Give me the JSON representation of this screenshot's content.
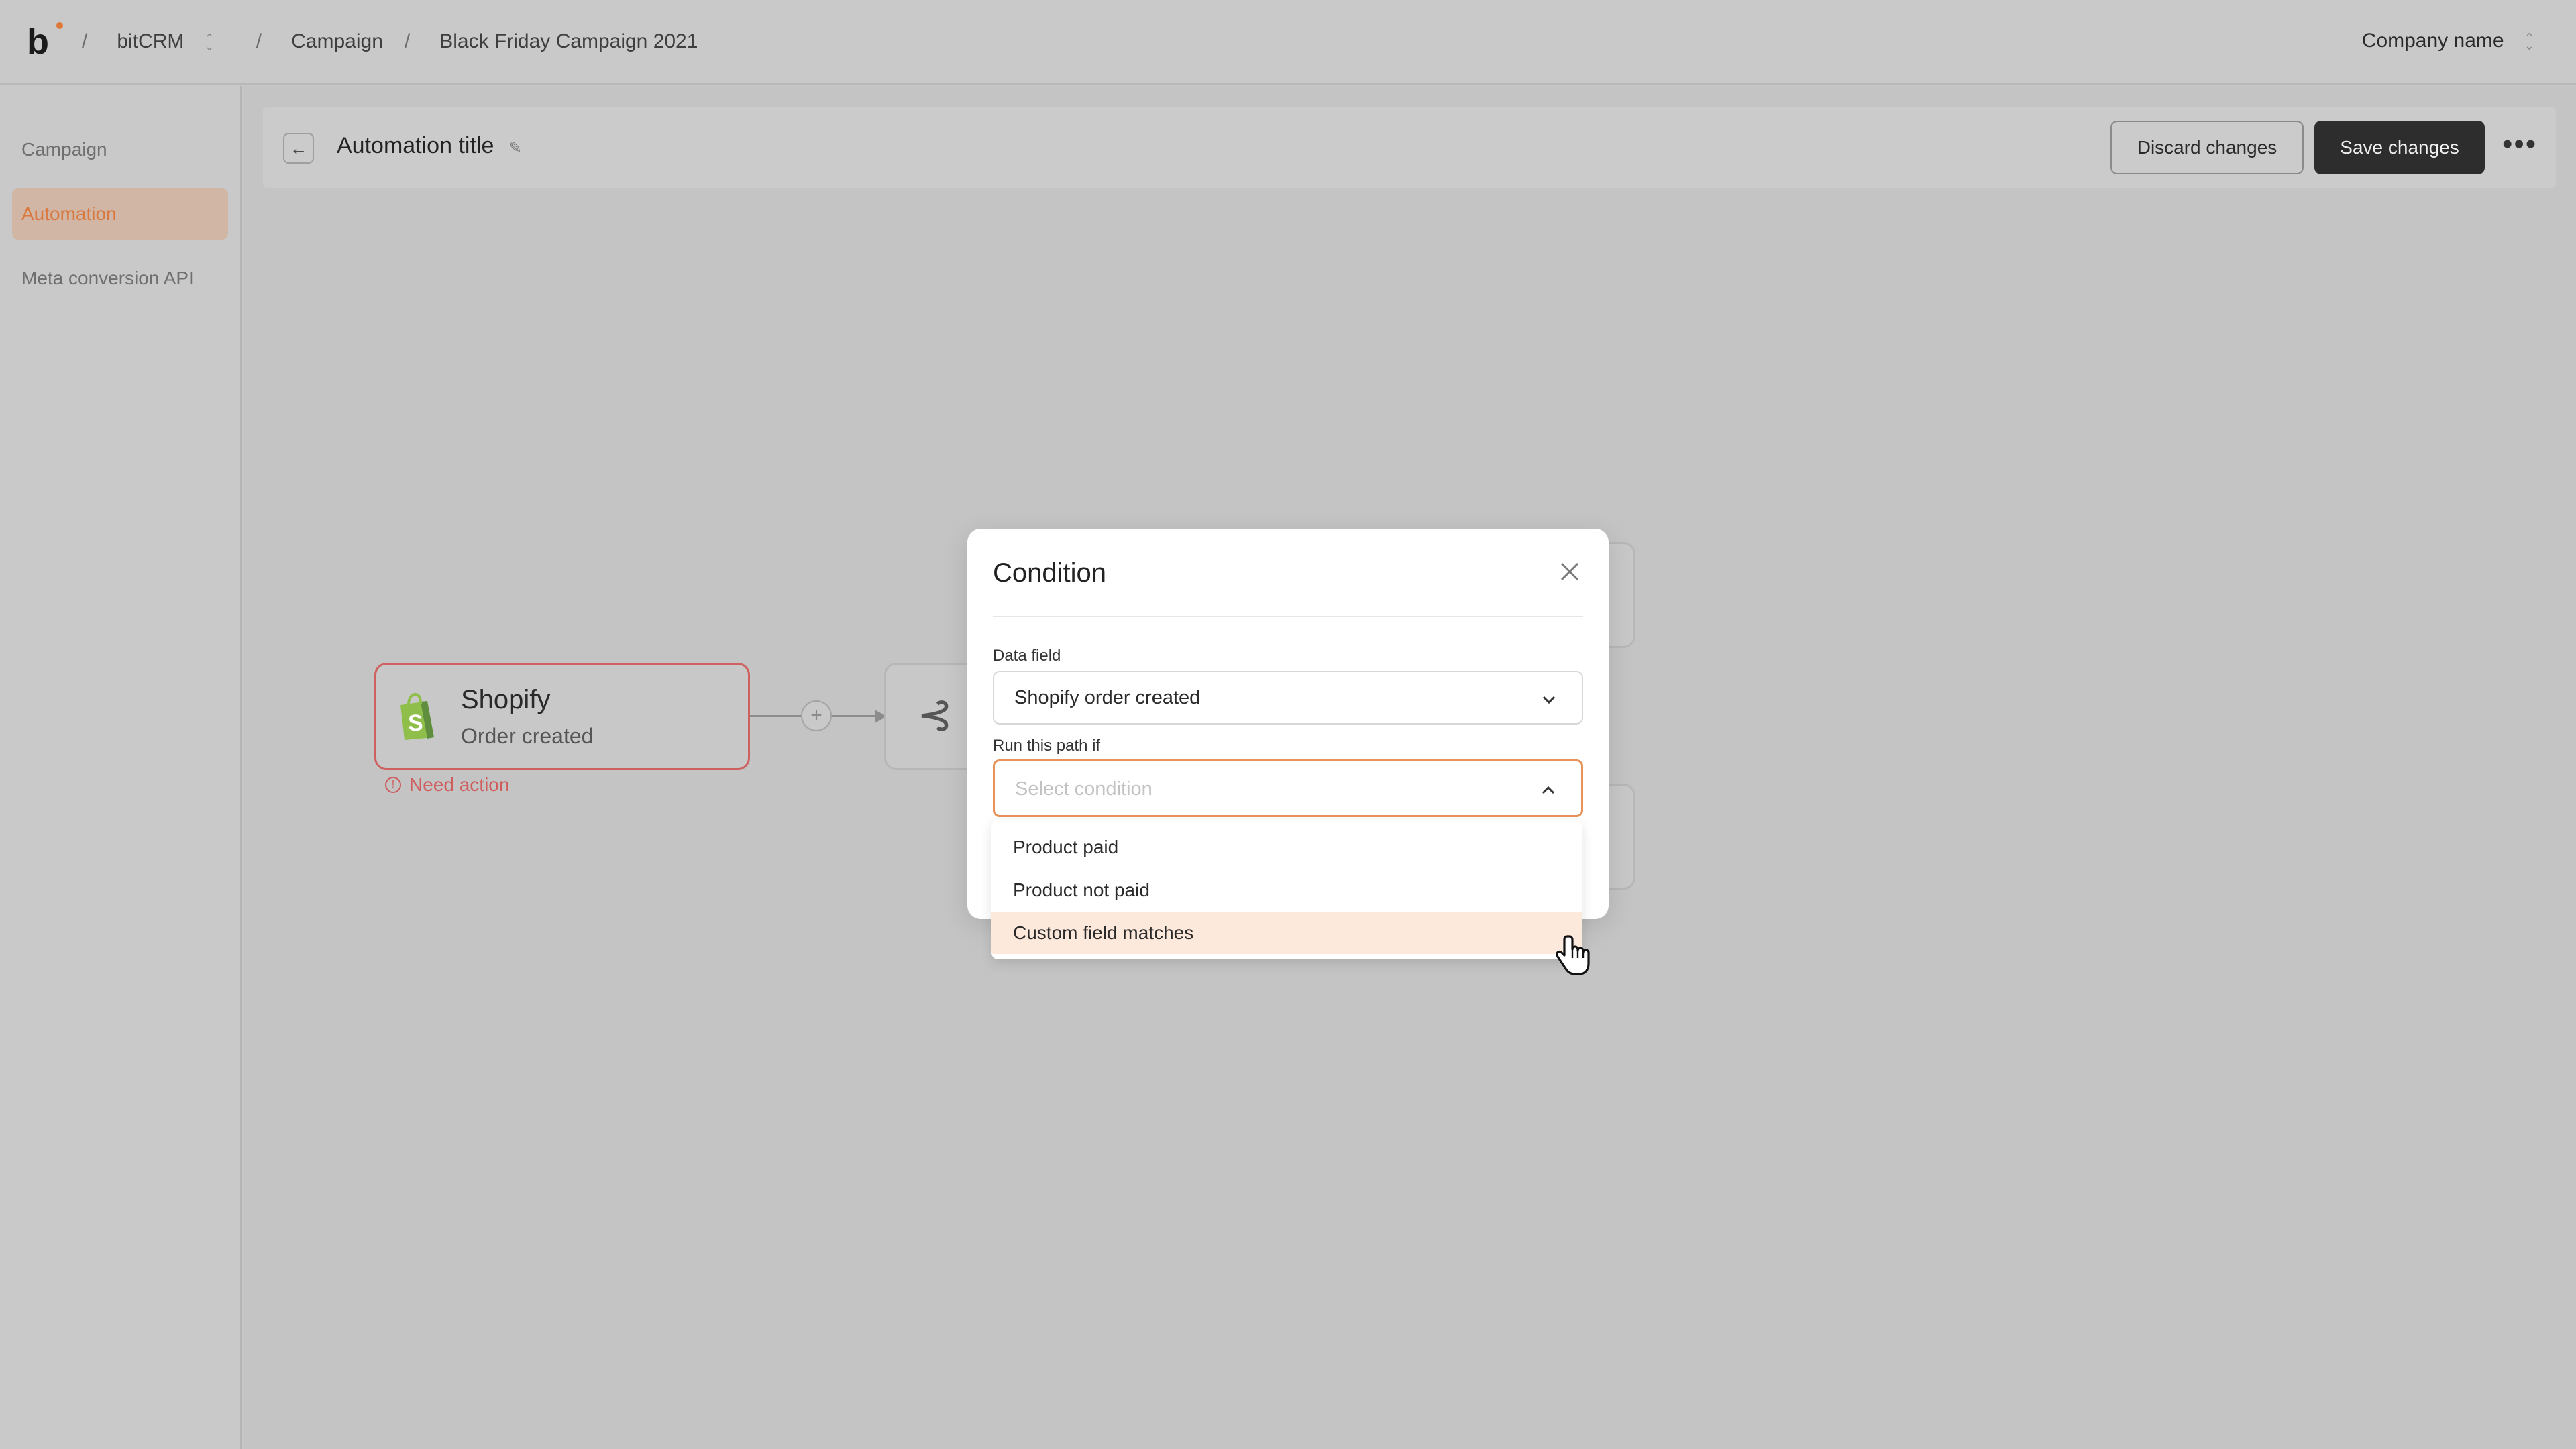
{
  "topbar": {
    "app_name": "bitCRM",
    "breadcrumb_1": "Campaign",
    "breadcrumb_2": "Black Friday Campaign 2021",
    "separator": "/",
    "company": "Company name"
  },
  "sidebar": {
    "items": [
      {
        "label": "Campaign",
        "active": false
      },
      {
        "label": "Automation",
        "active": true
      },
      {
        "label": "Meta conversion API",
        "active": false
      }
    ]
  },
  "automation": {
    "title": "Automation title",
    "discard_label": "Discard changes",
    "save_label": "Save changes"
  },
  "flow": {
    "trigger_title": "Shopify",
    "trigger_subtitle": "Order created",
    "trigger_status": "Need action"
  },
  "modal": {
    "title": "Condition",
    "data_field_label": "Data field",
    "data_field_value": "Shopify order created",
    "path_label": "Run this path if",
    "path_placeholder": "Select condition",
    "options": [
      "Product paid",
      "Product not paid",
      "Custom field matches"
    ],
    "hovered_option": "Custom field matches"
  },
  "colors": {
    "accent": "#e0783a",
    "error": "#cf5d5d",
    "primary_button": "#2d2d2d",
    "hover_option": "#fde8dc"
  }
}
